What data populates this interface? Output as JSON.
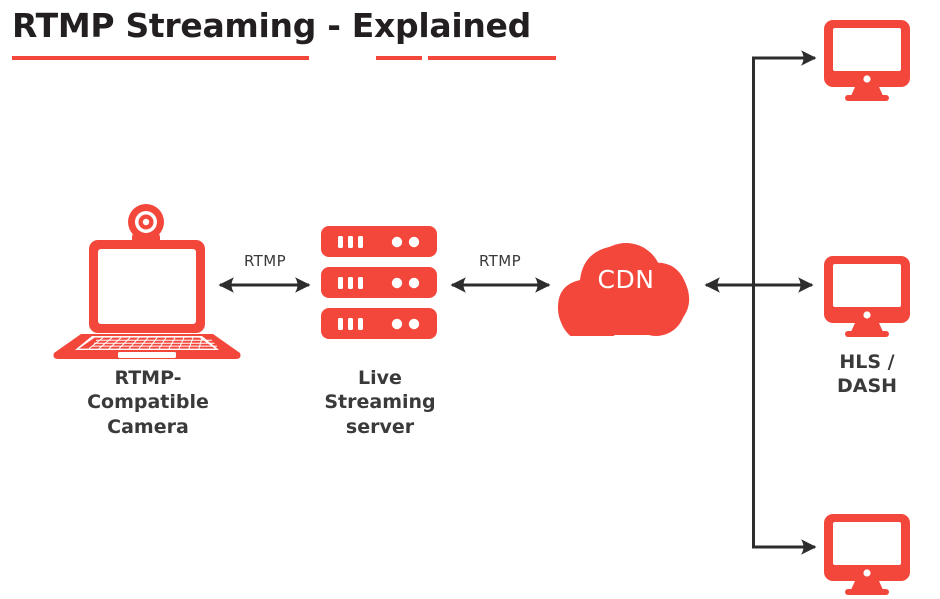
{
  "title": {
    "text": "RTMP Streaming - Explained",
    "underline_color": "#f4473c"
  },
  "colors": {
    "accent_red": "#f4473c",
    "text_dark": "#3a3a3a",
    "title_dark": "#231f20",
    "arrow_dark": "#2d2d2d",
    "background": "#ffffff"
  },
  "nodes": {
    "camera": {
      "icon": "laptop-webcam-icon",
      "label": "RTMP-\nCompatible\nCamera"
    },
    "server": {
      "icon": "server-rack-icon",
      "label": "Live\nStreaming\nserver"
    },
    "cdn": {
      "icon": "cloud-icon",
      "label": "CDN"
    },
    "viewer_top": {
      "icon": "monitor-icon",
      "label": ""
    },
    "viewer_middle": {
      "icon": "monitor-icon",
      "label": "HLS /\nDASH"
    },
    "viewer_bottom": {
      "icon": "monitor-icon",
      "label": ""
    }
  },
  "edges": {
    "camera_to_server": {
      "label": "RTMP",
      "direction": "bidirectional"
    },
    "server_to_cdn": {
      "label": "RTMP",
      "direction": "bidirectional"
    },
    "cdn_to_viewers": {
      "label": "",
      "direction": "bidirectional"
    },
    "trunk_to_top_viewer": {
      "label": "",
      "direction": "forward"
    },
    "trunk_to_bottom_viewer": {
      "label": "",
      "direction": "forward"
    }
  },
  "diagram_meta": {
    "type": "flow-diagram",
    "flow_order": [
      "camera",
      "server",
      "cdn",
      "viewers"
    ]
  }
}
